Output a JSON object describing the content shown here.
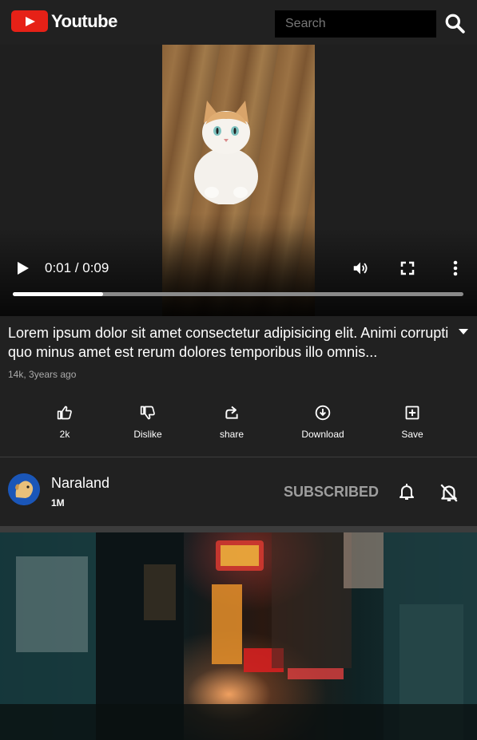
{
  "header": {
    "logo_text": "Youtube",
    "search_placeholder": "Search"
  },
  "player": {
    "time": "0:01 / 0:09",
    "progress": 0.2
  },
  "video": {
    "title": "Lorem ipsum dolor sit amet consectetur adipisicing elit. Animi corrupti quo minus amet est rerum dolores temporibus illo omnis...",
    "meta": "14k, 3years ago"
  },
  "actions": [
    {
      "label": "2k",
      "icon": "thumbs-up-icon"
    },
    {
      "label": "Dislike",
      "icon": "thumbs-down-icon"
    },
    {
      "label": "share",
      "icon": "share-icon"
    },
    {
      "label": "Download",
      "icon": "download-icon"
    },
    {
      "label": "Save",
      "icon": "add-box-icon"
    }
  ],
  "channel": {
    "name": "Naraland",
    "subscribers": "1M",
    "subscribe_label": "SUBSCRIBED"
  },
  "colors": {
    "background": "#212121",
    "brand_red": "#e62117",
    "subscribed_text": "#9e9e9e"
  }
}
